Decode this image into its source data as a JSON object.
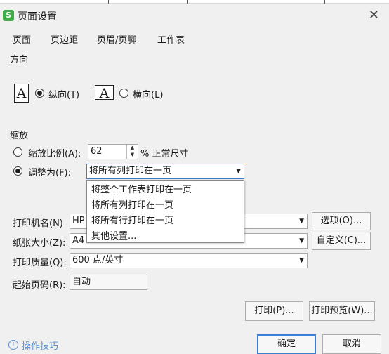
{
  "window": {
    "app_icon": "S",
    "title": "页面设置",
    "close": "✕"
  },
  "tabs": [
    "页面",
    "页边距",
    "页眉/页脚",
    "工作表"
  ],
  "orientation": {
    "label": "方向",
    "portrait_glyph": "A",
    "landscape_glyph": "A",
    "portrait": "纵向(T)",
    "landscape": "横向(L)"
  },
  "scaling": {
    "label": "缩放",
    "scale_option": "缩放比例(A):",
    "scale_value": "62",
    "scale_unit": "% 正常尺寸",
    "fit_option": "调整为(F):",
    "fit_value": "将所有列打印在一页",
    "dropdown_options": [
      "将整个工作表打印在一页",
      "将所有列打印在一页",
      "将所有行打印在一页",
      "其他设置..."
    ]
  },
  "printer": {
    "label": "打印机名(N)",
    "value": "HP",
    "options_button": "选项(O)..."
  },
  "paper": {
    "label": "纸张大小(Z):",
    "value": "A4",
    "custom_button": "自定义(C)..."
  },
  "quality": {
    "label": "打印质量(Q):",
    "value": "600 点/英寸"
  },
  "first_page": {
    "label": "起始页码(R):",
    "value": "自动"
  },
  "footer": {
    "print_button": "打印(P)...",
    "preview_button": "打印预览(W)...",
    "tips_link": "操作技巧",
    "ok_button": "确定",
    "cancel_button": "取消"
  },
  "icons": {
    "radio": "radio-icon",
    "dropdown": "chevron-down-icon",
    "tips": "info-icon"
  }
}
